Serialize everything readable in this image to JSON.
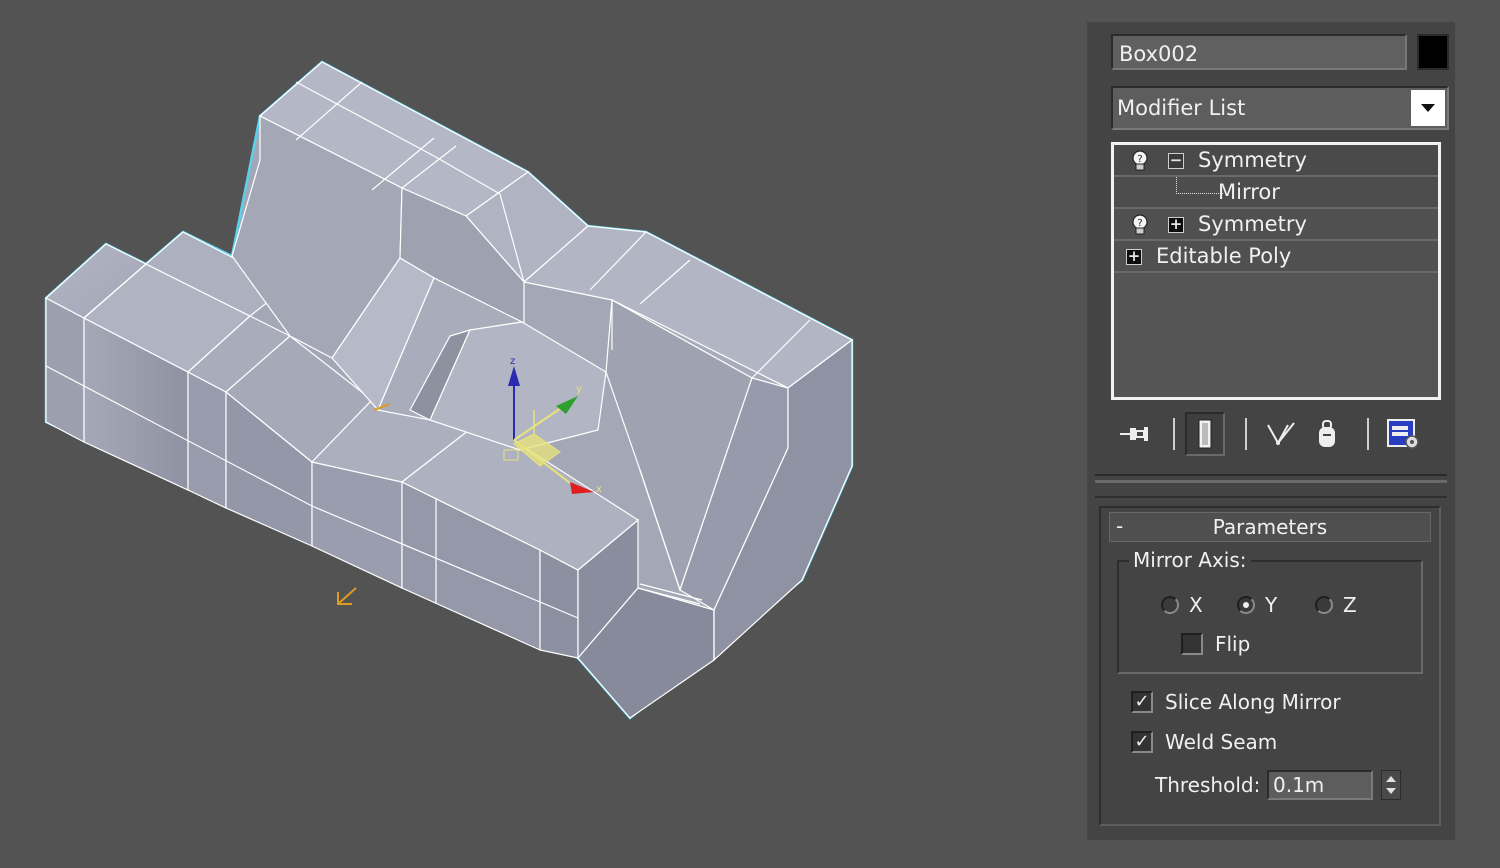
{
  "viewport": {
    "axis_labels": {
      "x": "x",
      "y": "y",
      "z": "z"
    },
    "colors": {
      "background": "#535353",
      "mesh_fill": "#a7aab9",
      "wire": "#ffffff",
      "selection_outline": "#5bd0ea",
      "gizmo_x": "#e02020",
      "gizmo_y": "#2ea02e",
      "gizmo_z": "#2a2ab0",
      "gizmo_plane": "#e8e47a",
      "pivot": "#e09a20"
    }
  },
  "panel": {
    "object_name": "Box002",
    "object_color": "#000000",
    "modifier_list_label": "Modifier List",
    "stack": [
      {
        "label": "Symmetry",
        "expander": "minus",
        "has_bulb": true
      },
      {
        "label": "Mirror",
        "sub_object": true
      },
      {
        "label": "Symmetry",
        "expander": "plus",
        "has_bulb": true
      },
      {
        "label": "Editable Poly",
        "expander": "plus",
        "has_bulb": false
      }
    ],
    "toolbar_icons": [
      "pin-stack-icon",
      "show-end-result-icon",
      "make-unique-icon",
      "remove-modifier-icon",
      "configure-modifier-sets-icon"
    ],
    "parameters": {
      "rollout_sign": "-",
      "title": "Parameters",
      "mirror_axis_label": "Mirror Axis:",
      "axes": [
        {
          "label": "X",
          "selected": false
        },
        {
          "label": "Y",
          "selected": true
        },
        {
          "label": "Z",
          "selected": false
        }
      ],
      "flip_label": "Flip",
      "flip_checked": false,
      "slice_label": "Slice Along Mirror",
      "slice_checked": true,
      "weld_label": "Weld Seam",
      "weld_checked": true,
      "threshold_label": "Threshold:",
      "threshold_value": "0.1m"
    }
  }
}
